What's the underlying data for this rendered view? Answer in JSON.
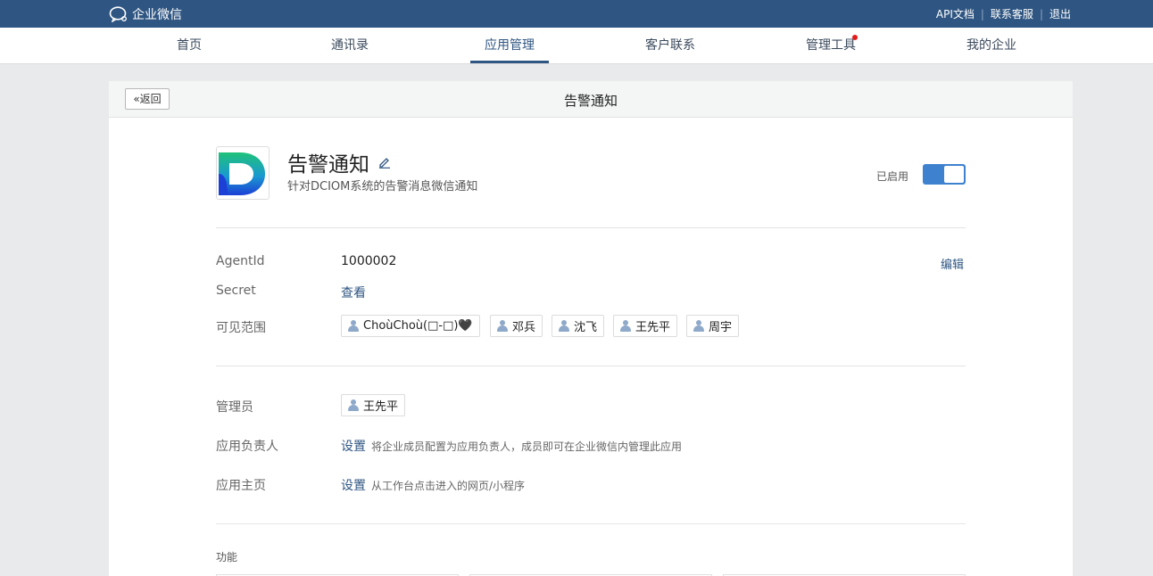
{
  "topbar": {
    "brand": "企业微信",
    "links": [
      "API文档",
      "联系客服",
      "退出"
    ],
    "separator": "|"
  },
  "nav": {
    "items": [
      {
        "label": "首页",
        "active": false,
        "dot": false
      },
      {
        "label": "通讯录",
        "active": false,
        "dot": false
      },
      {
        "label": "应用管理",
        "active": true,
        "dot": false
      },
      {
        "label": "客户联系",
        "active": false,
        "dot": false
      },
      {
        "label": "管理工具",
        "active": false,
        "dot": true
      },
      {
        "label": "我的企业",
        "active": false,
        "dot": false
      }
    ]
  },
  "page": {
    "back_label": "返回",
    "title": "告警通知"
  },
  "app": {
    "name": "告警通知",
    "description": "针对DCIOM系统的告警消息微信通知",
    "status_label": "已启用",
    "enabled": true
  },
  "details": {
    "agentid_label": "AgentId",
    "agentid_value": "1000002",
    "edit_label": "编辑",
    "secret_label": "Secret",
    "secret_action": "查看",
    "scope_label": "可见范围",
    "scope_members": [
      "ChoùChoù(□-□)🖤",
      "邓兵",
      "沈飞",
      "王先平",
      "周宇"
    ]
  },
  "admin": {
    "admin_label": "管理员",
    "admin_members": [
      "王先平"
    ],
    "owner_label": "应用负责人",
    "owner_action": "设置",
    "owner_hint": "将企业成员配置为应用负责人，成员即可在企业微信内管理此应用",
    "home_label": "应用主页",
    "home_action": "设置",
    "home_hint": "从工作台点击进入的网页/小程序"
  },
  "features": {
    "label": "功能"
  },
  "colors": {
    "topbar": "#2f5682",
    "accent": "#3e82cf",
    "nav_dot": "#e21b1b"
  }
}
